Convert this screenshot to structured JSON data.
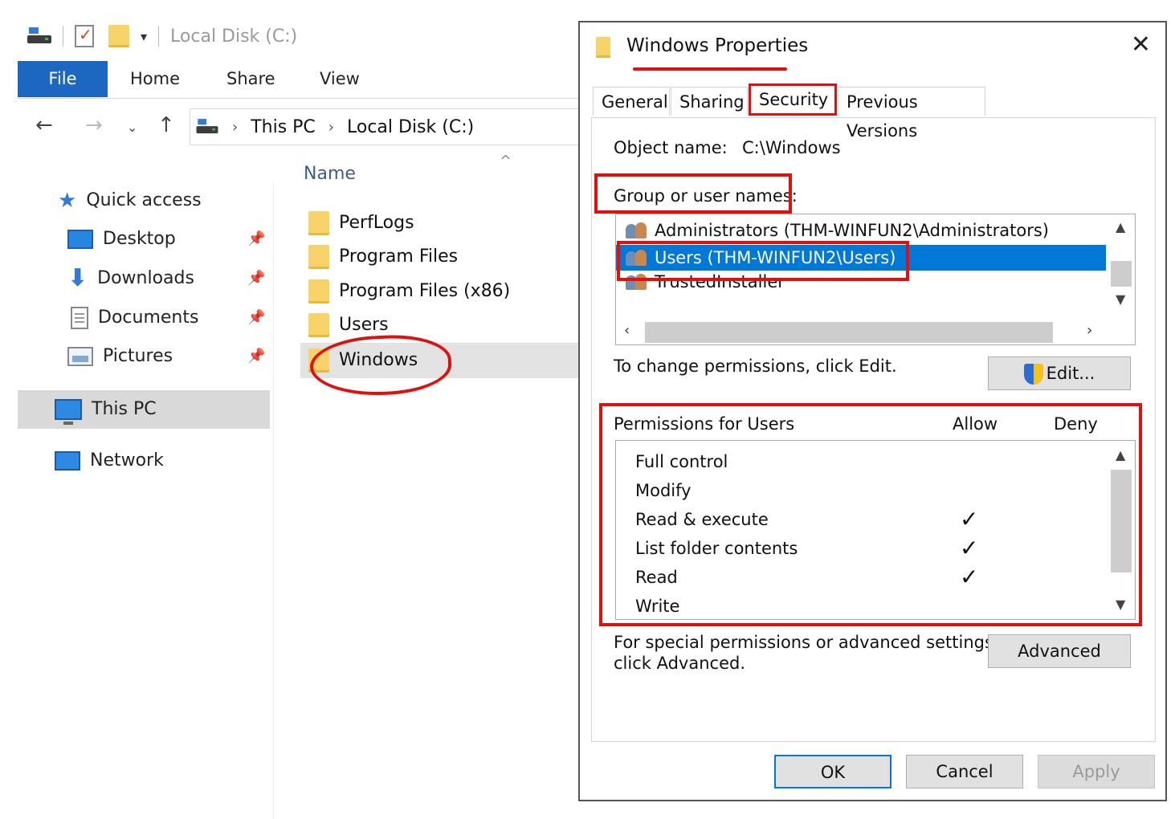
{
  "explorer": {
    "window_title": "Local Disk (C:)",
    "ribbon_tabs": [
      "File",
      "Home",
      "Share",
      "View"
    ],
    "breadcrumb": [
      "This PC",
      "Local Disk (C:)"
    ],
    "nav": {
      "quick_access": "Quick access",
      "desktop": "Desktop",
      "downloads": "Downloads",
      "documents": "Documents",
      "pictures": "Pictures",
      "this_pc": "This PC",
      "network": "Network"
    },
    "column_header": "Name",
    "files": [
      "PerfLogs",
      "Program Files",
      "Program Files (x86)",
      "Users",
      "Windows"
    ],
    "selected_file": "Windows"
  },
  "dialog": {
    "title": "Windows Properties",
    "tabs": [
      "General",
      "Sharing",
      "Security",
      "Previous Versions"
    ],
    "active_tab": "Security",
    "object_name_label": "Object name:",
    "object_name_value": "C:\\Windows",
    "group_label": "Group or user names:",
    "groups": [
      "Administrators (THM-WINFUN2\\Administrators)",
      "Users (THM-WINFUN2\\Users)",
      "TrustedInstaller"
    ],
    "selected_group": "Users (THM-WINFUN2\\Users)",
    "change_text": "To change permissions, click Edit.",
    "edit_button": "Edit...",
    "permissions_label": "Permissions for Users",
    "allow_header": "Allow",
    "deny_header": "Deny",
    "permissions": [
      {
        "name": "Full control",
        "allow": ""
      },
      {
        "name": "Modify",
        "allow": ""
      },
      {
        "name": "Read & execute",
        "allow": "✓"
      },
      {
        "name": "List folder contents",
        "allow": "✓"
      },
      {
        "name": "Read",
        "allow": "✓"
      },
      {
        "name": "Write",
        "allow": ""
      }
    ],
    "special_text_line1": "For special permissions or advanced settings,",
    "special_text_line2": "click Advanced.",
    "advanced_button": "Advanced",
    "ok_button": "OK",
    "cancel_button": "Cancel",
    "apply_button": "Apply"
  },
  "colors": {
    "annotation_red": "#e20f0f",
    "selection_blue": "#0078d7",
    "file_tab_blue": "#1c67c0"
  }
}
